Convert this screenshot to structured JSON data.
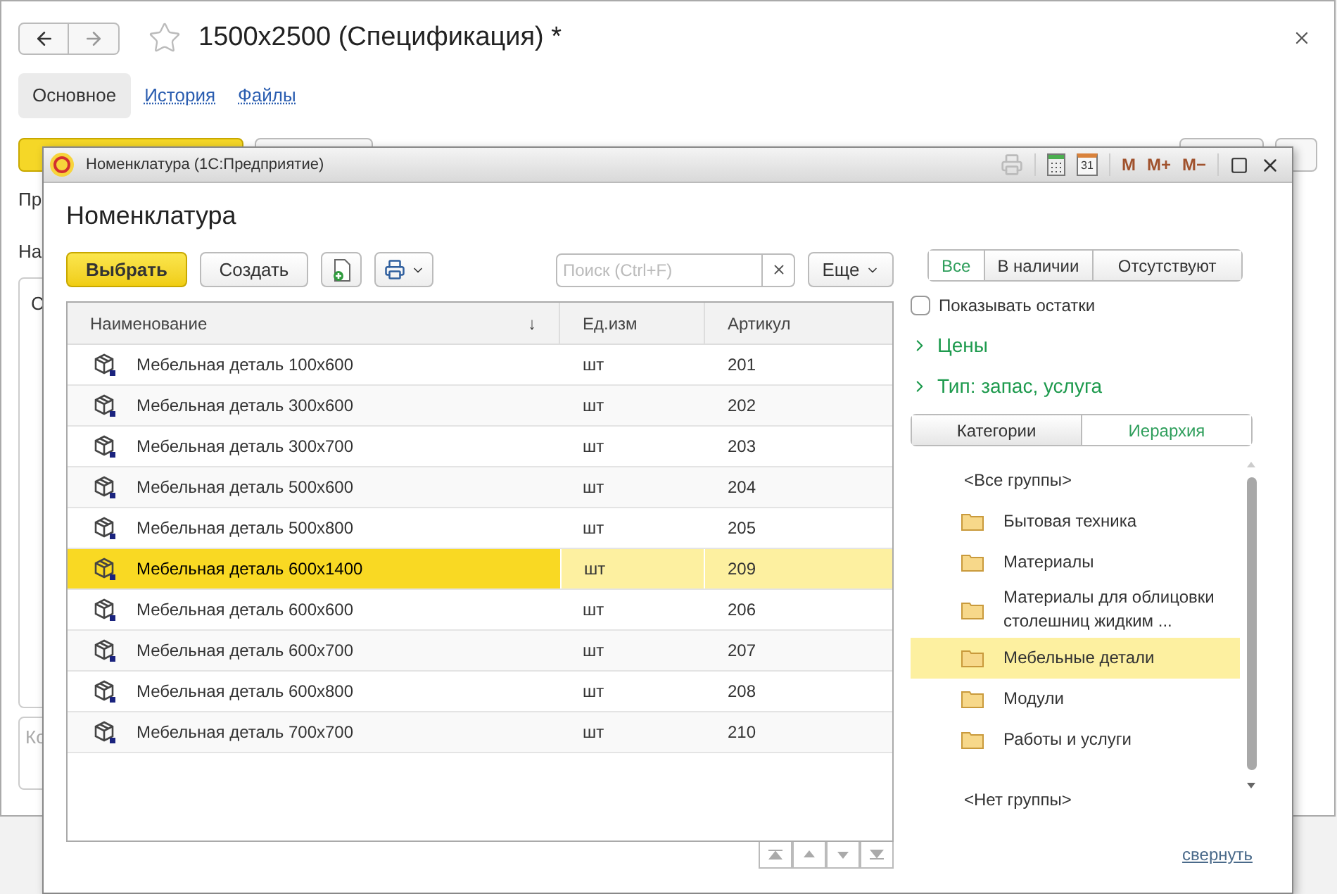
{
  "main_window": {
    "title": "1500x2500 (Спецификация) *",
    "tabs": [
      {
        "label": "Основное",
        "selected": true
      },
      {
        "label": "История",
        "selected": false
      },
      {
        "label": "Файлы",
        "selected": false
      }
    ],
    "fragments": [
      "Пр",
      "На",
      "С"
    ],
    "comment_fragment": "Ко"
  },
  "dialog": {
    "title": "Номенклатура  (1С:Предприятие)",
    "calendar_day": "31",
    "memory_buttons": [
      "M",
      "M+",
      "M−"
    ],
    "heading": "Номенклатура",
    "toolbar": {
      "select_button": "Выбрать",
      "create_button": "Создать",
      "search": {
        "placeholder": "Поиск (Ctrl+F)"
      },
      "more_button": "Еще"
    },
    "table": {
      "columns": [
        {
          "label": "Наименование",
          "sort_mark": "↓"
        },
        {
          "label": "Ед.изм"
        },
        {
          "label": "Артикул"
        }
      ],
      "rows": [
        {
          "name": "Мебельная деталь 100x600",
          "unit": "шт",
          "article": "201",
          "selected": false
        },
        {
          "name": "Мебельная деталь 300x600",
          "unit": "шт",
          "article": "202",
          "selected": false
        },
        {
          "name": "Мебельная деталь 300x700",
          "unit": "шт",
          "article": "203",
          "selected": false
        },
        {
          "name": "Мебельная деталь 500x600",
          "unit": "шт",
          "article": "204",
          "selected": false
        },
        {
          "name": "Мебельная деталь 500x800",
          "unit": "шт",
          "article": "205",
          "selected": false
        },
        {
          "name": "Мебельная деталь 600x1400",
          "unit": "шт",
          "article": "209",
          "selected": true
        },
        {
          "name": "Мебельная деталь 600x600",
          "unit": "шт",
          "article": "206",
          "selected": false
        },
        {
          "name": "Мебельная деталь 600x700",
          "unit": "шт",
          "article": "207",
          "selected": false
        },
        {
          "name": "Мебельная деталь 600x800",
          "unit": "шт",
          "article": "208",
          "selected": false
        },
        {
          "name": "Мебельная деталь 700x700",
          "unit": "шт",
          "article": "210",
          "selected": false
        }
      ]
    },
    "filters": [
      {
        "label": "Все",
        "selected": true
      },
      {
        "label": "В наличии",
        "selected": false
      },
      {
        "label": "Отсутствуют",
        "selected": false
      }
    ],
    "show_remainders": {
      "label": "Показывать остатки",
      "checked": false
    },
    "sections": [
      {
        "label": "Цены",
        "expanded": false
      },
      {
        "label": "Тип: запас, услуга",
        "expanded": false
      }
    ],
    "view_tabs": [
      {
        "label": "Категории",
        "selected": false
      },
      {
        "label": "Иерархия",
        "selected": true
      }
    ],
    "groups": [
      {
        "kind": "special",
        "label": "<Все группы>",
        "selected": false
      },
      {
        "kind": "folder",
        "label": "Бытовая техника",
        "selected": false
      },
      {
        "kind": "folder",
        "label": "Материалы",
        "selected": false
      },
      {
        "kind": "folder",
        "label": "Материалы для облицовки столешниц жидким ...",
        "selected": false
      },
      {
        "kind": "folder",
        "label": "Мебельные детали",
        "selected": true
      },
      {
        "kind": "folder",
        "label": "Модули",
        "selected": false
      },
      {
        "kind": "folder",
        "label": "Работы и услуги",
        "selected": false
      },
      {
        "kind": "spacer"
      },
      {
        "kind": "special",
        "label": "<Нет группы>",
        "selected": false
      }
    ],
    "collapse_link": "свернуть"
  }
}
